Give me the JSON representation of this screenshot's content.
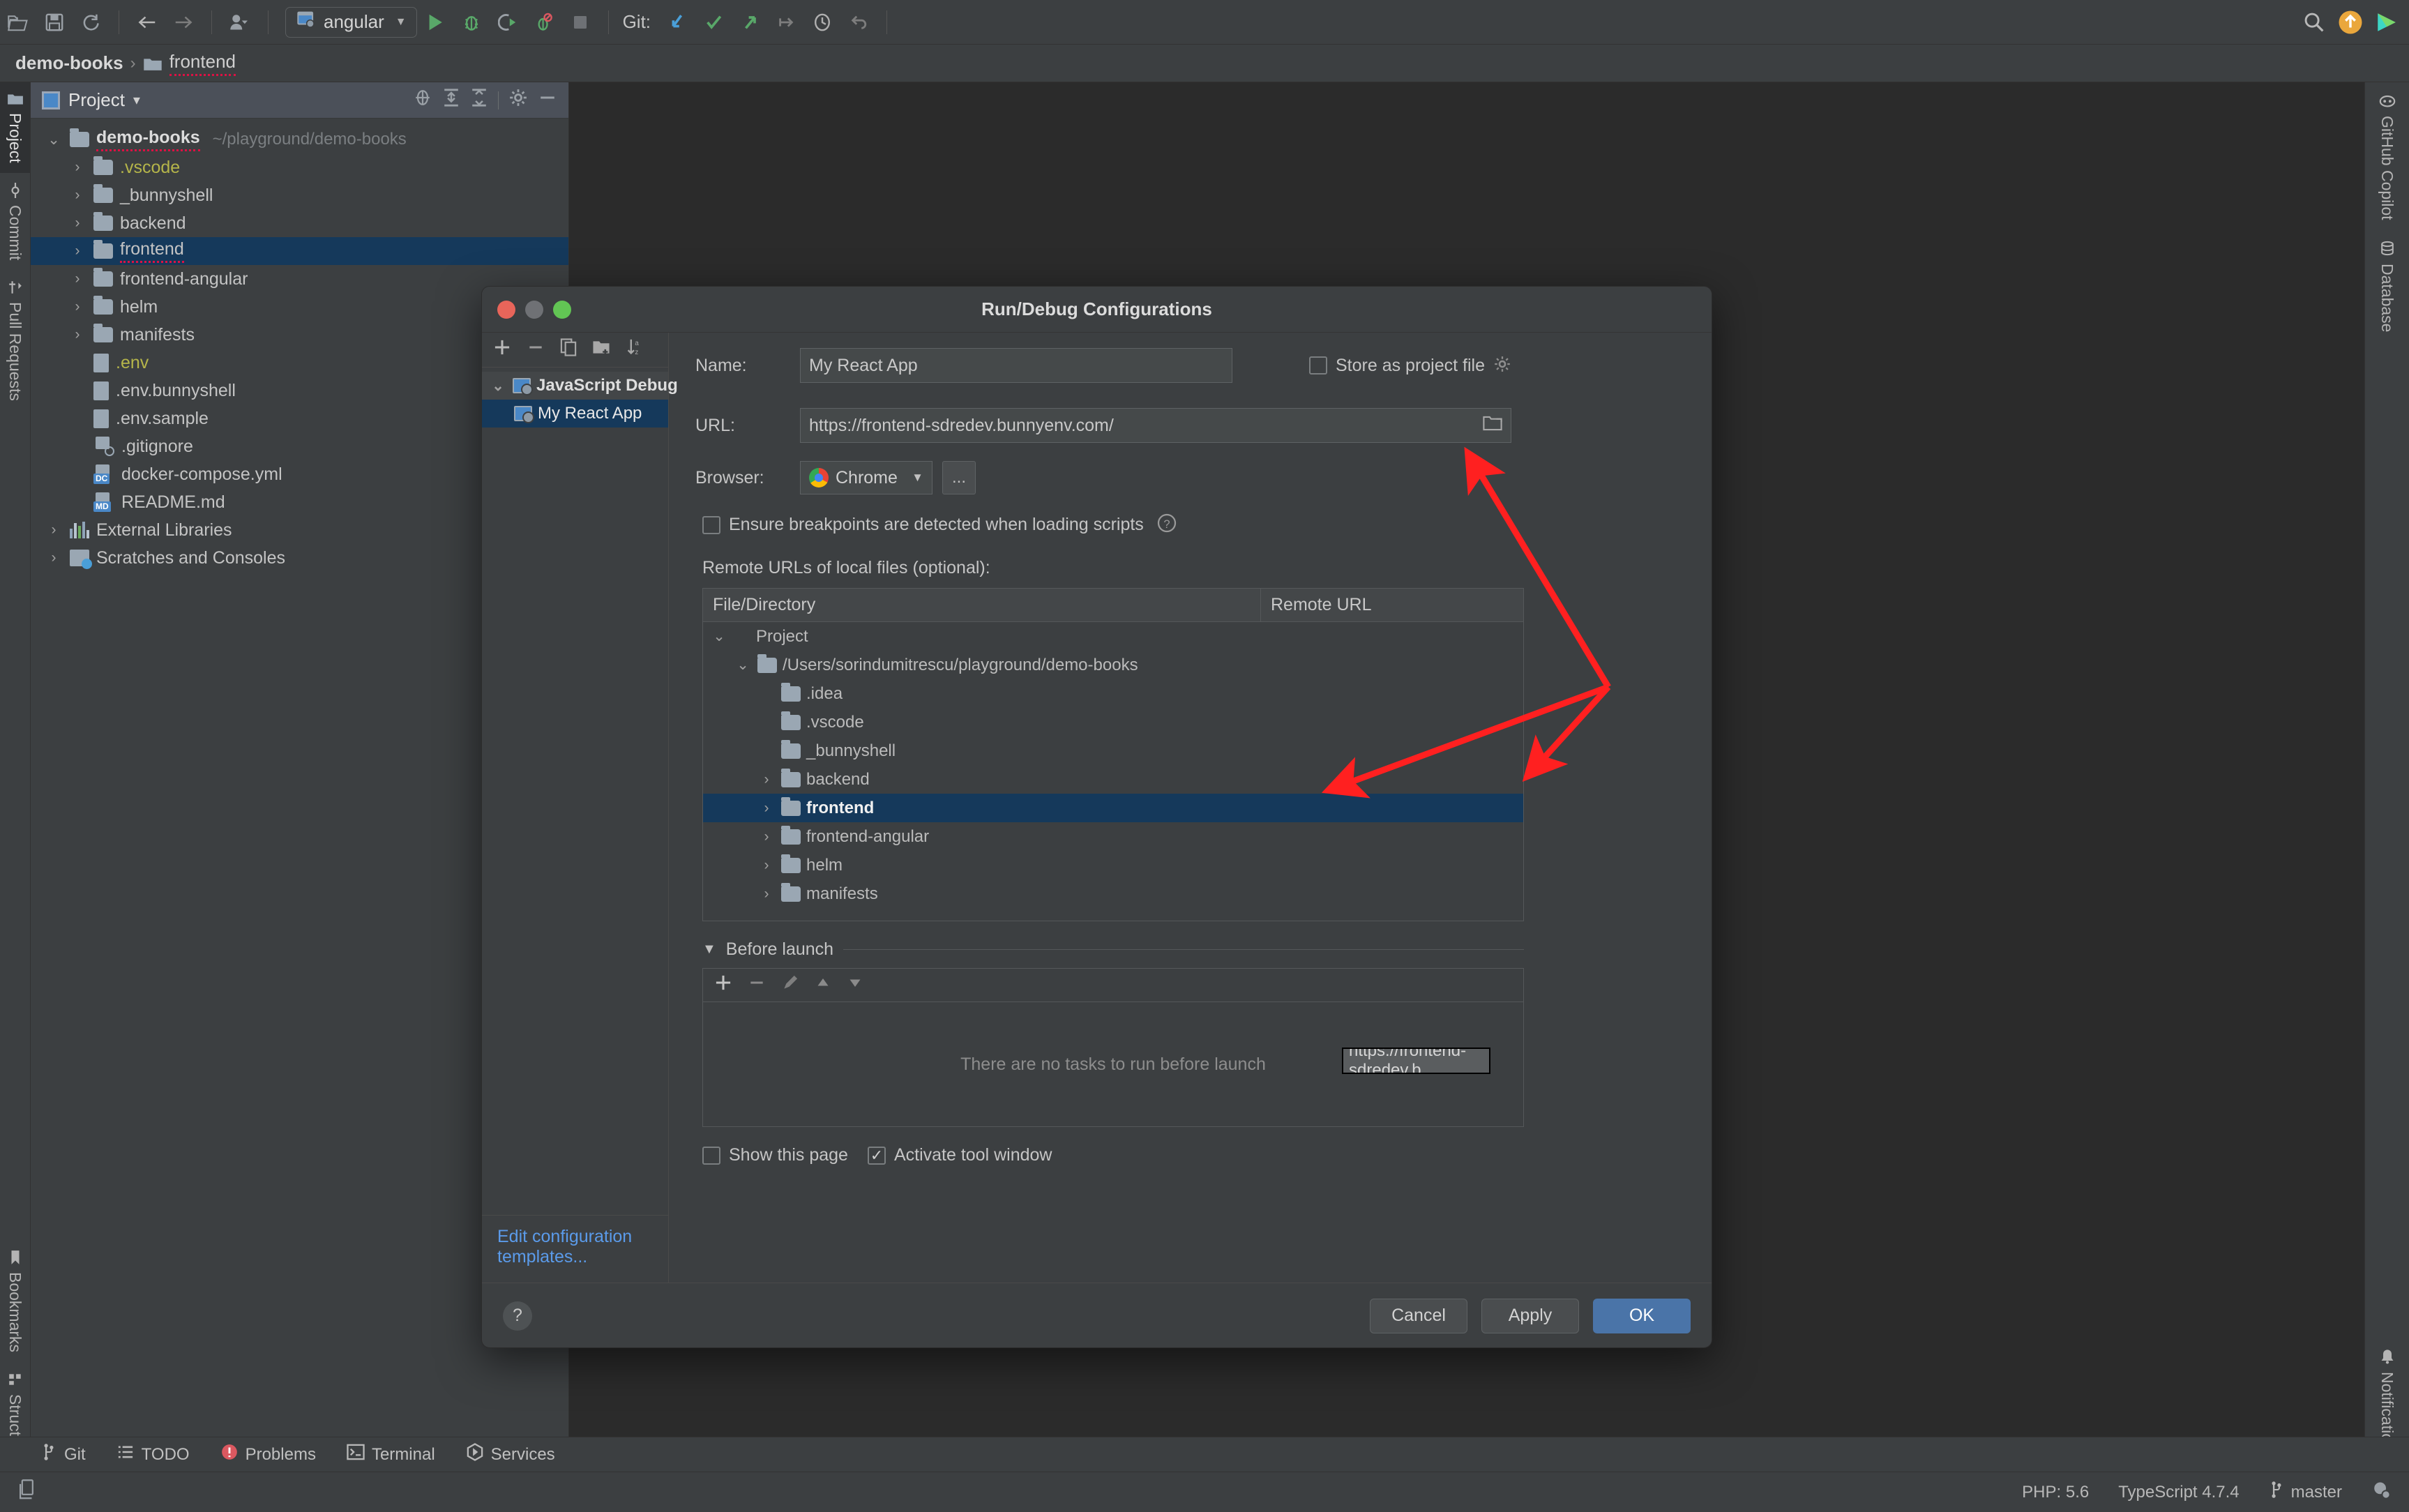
{
  "toolbar": {
    "icons": [
      "open-folder-icon",
      "save-icon",
      "sync-icon",
      "back-arrow-icon",
      "forward-arrow-icon",
      "user-avatar-icon"
    ],
    "run_config": {
      "label": "angular",
      "icon": "js-debug-config-icon"
    },
    "run_label": "Run",
    "git_label": "Git:",
    "search_icon": "search-icon",
    "update_icon": "update-arrow-icon",
    "product_icon": "jetbrains-icon"
  },
  "breadcrumb": {
    "root": "demo-books",
    "separator": "›",
    "item": "frontend"
  },
  "left_rail": {
    "top": [
      {
        "label": "Project",
        "icon": "project-folder-icon",
        "active": true
      },
      {
        "label": "Commit",
        "icon": "commit-icon",
        "active": false
      },
      {
        "label": "Pull Requests",
        "icon": "pull-request-icon",
        "active": false
      }
    ],
    "bottom": [
      {
        "label": "Bookmarks",
        "icon": "bookmark-icon"
      },
      {
        "label": "Structure",
        "icon": "structure-icon"
      }
    ]
  },
  "right_rail": {
    "top": [
      {
        "label": "GitHub Copilot",
        "icon": "github-copilot-icon"
      },
      {
        "label": "Database",
        "icon": "database-icon"
      }
    ],
    "bottom": [
      {
        "label": "Notifications",
        "icon": "bell-icon"
      }
    ]
  },
  "project_panel": {
    "title": "Project",
    "dropdown_caret": "▾",
    "actions": [
      "locate-icon",
      "expand-all-icon",
      "collapse-all-icon",
      "gear-icon",
      "minimize-icon"
    ],
    "tree": [
      {
        "depth": 0,
        "arrow": "⌄",
        "icon": "folder-icon",
        "name": "demo-books",
        "bold": true,
        "path": "~/playground/demo-books",
        "squiggle": true
      },
      {
        "depth": 1,
        "arrow": "›",
        "icon": "folder-icon",
        "name": ".vscode",
        "color": "yellow"
      },
      {
        "depth": 1,
        "arrow": "›",
        "icon": "folder-icon",
        "name": "_bunnyshell"
      },
      {
        "depth": 1,
        "arrow": "›",
        "icon": "folder-icon",
        "name": "backend"
      },
      {
        "depth": 1,
        "arrow": "›",
        "icon": "folder-icon",
        "name": "frontend",
        "selected": true,
        "squiggle": true
      },
      {
        "depth": 1,
        "arrow": "›",
        "icon": "folder-icon",
        "name": "frontend-angular"
      },
      {
        "depth": 1,
        "arrow": "›",
        "icon": "folder-icon",
        "name": "helm"
      },
      {
        "depth": 1,
        "arrow": "›",
        "icon": "folder-icon",
        "name": "manifests"
      },
      {
        "depth": 1,
        "arrow": "",
        "icon": "file-icon",
        "name": ".env",
        "color": "yellow"
      },
      {
        "depth": 1,
        "arrow": "",
        "icon": "file-icon",
        "name": ".env.bunnyshell"
      },
      {
        "depth": 1,
        "arrow": "",
        "icon": "file-icon",
        "name": ".env.sample"
      },
      {
        "depth": 1,
        "arrow": "",
        "icon": "gitignore-file-icon",
        "name": ".gitignore"
      },
      {
        "depth": 1,
        "arrow": "",
        "icon": "docker-compose-file-icon",
        "badge": "DC",
        "name": "docker-compose.yml"
      },
      {
        "depth": 1,
        "arrow": "",
        "icon": "markdown-file-icon",
        "badge": "MD",
        "name": "README.md"
      },
      {
        "depth": 0,
        "arrow": "›",
        "icon": "external-libraries-icon",
        "name": "External Libraries"
      },
      {
        "depth": 0,
        "arrow": "›",
        "icon": "scratches-icon",
        "name": "Scratches and Consoles"
      }
    ]
  },
  "dialog": {
    "title": "Run/Debug Configurations",
    "window_buttons": [
      "close-button",
      "minimize-button",
      "zoom-button"
    ],
    "left_toolbar": [
      "add-icon",
      "remove-icon",
      "copy-icon",
      "save-as-folder-icon",
      "sort-az-icon"
    ],
    "config_tree": [
      {
        "label": "JavaScript Debug",
        "group": true,
        "arrow": "⌄",
        "icon": "js-debug-icon"
      },
      {
        "label": "My React App",
        "group": false,
        "selected": true,
        "icon": "js-debug-config-icon"
      }
    ],
    "edit_templates_link": "Edit configuration templates...",
    "name_label": "Name:",
    "name_value": "My React App",
    "store_as_project_file": {
      "label": "Store as project file",
      "checked": false,
      "gear_icon": "gear-icon"
    },
    "url_label": "URL:",
    "url_value": "https://frontend-sdredev.bunnyenv.com/",
    "url_browse_icon": "folder-browse-icon",
    "browser_label": "Browser:",
    "browser_value": "Chrome",
    "browser_icon": "chrome-icon",
    "browser_more_label": "...",
    "ensure_breakpoints": {
      "label": "Ensure breakpoints are detected when loading scripts",
      "checked": false,
      "help_icon": "help-circle-icon"
    },
    "remote_urls_label": "Remote URLs of local files (optional):",
    "table_headers": [
      "File/Directory",
      "Remote URL"
    ],
    "table_rows": [
      {
        "depth": 0,
        "arrow": "⌄",
        "icon": "project-icon",
        "name": "Project",
        "remote": ""
      },
      {
        "depth": 1,
        "arrow": "⌄",
        "icon": "folder-icon",
        "name": "/Users/sorindumitrescu/playground/demo-books",
        "remote": ""
      },
      {
        "depth": 2,
        "arrow": "",
        "icon": "folder-icon",
        "name": ".idea",
        "remote": ""
      },
      {
        "depth": 2,
        "arrow": "",
        "icon": "folder-icon",
        "name": ".vscode",
        "remote": ""
      },
      {
        "depth": 2,
        "arrow": "",
        "icon": "folder-icon",
        "name": "_bunnyshell",
        "remote": ""
      },
      {
        "depth": 2,
        "arrow": "›",
        "icon": "folder-icon",
        "name": "backend",
        "remote": ""
      },
      {
        "depth": 2,
        "arrow": "›",
        "icon": "folder-icon",
        "name": "frontend",
        "remote": "",
        "selected": true
      },
      {
        "depth": 2,
        "arrow": "›",
        "icon": "folder-icon",
        "name": "frontend-angular",
        "remote": ""
      },
      {
        "depth": 2,
        "arrow": "›",
        "icon": "folder-icon",
        "name": "helm",
        "remote": ""
      },
      {
        "depth": 2,
        "arrow": "›",
        "icon": "folder-icon",
        "name": "manifests",
        "remote": ""
      }
    ],
    "inline_edit_value": "https://frontend-sdredev.b",
    "before_launch": {
      "label": "Before launch",
      "collapse_icon": "triangle-down-icon",
      "toolbar": [
        "add-icon",
        "remove-icon",
        "edit-pencil-icon",
        "move-up-icon",
        "move-down-icon"
      ],
      "empty_text": "There are no tasks to run before launch"
    },
    "show_this_page": {
      "label": "Show this page",
      "checked": false
    },
    "activate_tool_window": {
      "label": "Activate tool window",
      "checked": true
    },
    "help_button": "?",
    "buttons": {
      "cancel": "Cancel",
      "apply": "Apply",
      "ok": "OK"
    }
  },
  "tool_strip": [
    {
      "label": "Git",
      "icon": "git-branch-icon"
    },
    {
      "label": "TODO",
      "icon": "todo-list-icon"
    },
    {
      "label": "Problems",
      "icon": "problems-error-icon"
    },
    {
      "label": "Terminal",
      "icon": "terminal-icon"
    },
    {
      "label": "Services",
      "icon": "services-icon"
    }
  ],
  "status_bar": {
    "left_icon": "multi-file-icon",
    "php": "PHP: 5.6",
    "typescript": "TypeScript 4.7.4",
    "branch": "master",
    "branch_icon": "git-branch-icon",
    "right_icon": "inspection-icon"
  },
  "colors": {
    "accent_blue": "#4a74a8",
    "selection_blue": "#15395b",
    "link_blue": "#5b9bea",
    "annotation_red": "#ff2020",
    "panel_bg": "#3c3f41",
    "editor_bg": "#2b2b2b"
  }
}
